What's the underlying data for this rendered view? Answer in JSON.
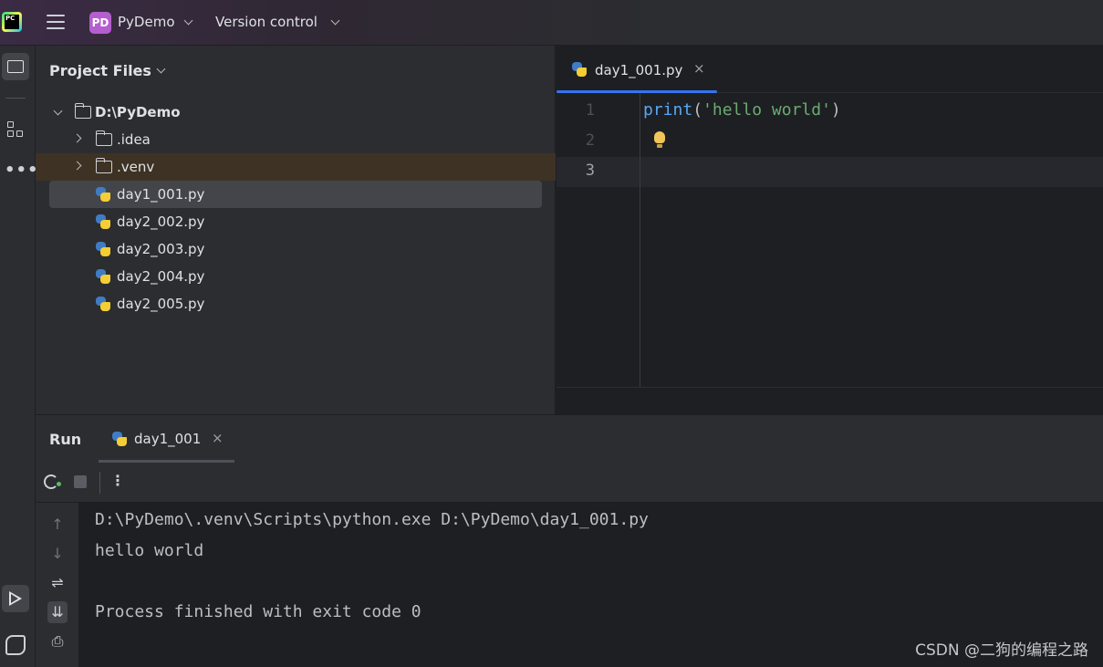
{
  "titlebar": {
    "app_logo_text": "PC",
    "project_badge": "PD",
    "project_name": "PyDemo",
    "vcs_label": "Version control"
  },
  "project_panel": {
    "title": "Project Files",
    "tree": [
      {
        "label": "D:\\PyDemo",
        "kind": "folder",
        "expanded": true
      },
      {
        "label": ".idea",
        "kind": "folder",
        "expanded": false
      },
      {
        "label": ".venv",
        "kind": "folder",
        "expanded": false
      },
      {
        "label": "day1_001.py",
        "kind": "python-file",
        "selected": true
      },
      {
        "label": "day2_002.py",
        "kind": "python-file"
      },
      {
        "label": "day2_003.py",
        "kind": "python-file"
      },
      {
        "label": "day2_004.py",
        "kind": "python-file"
      },
      {
        "label": "day2_005.py",
        "kind": "python-file"
      }
    ]
  },
  "editor": {
    "tab_label": "day1_001.py",
    "close_glyph": "×",
    "line_numbers": [
      "1",
      "2",
      "3"
    ],
    "code": {
      "fn": "print",
      "open_paren": "(",
      "string": "'hello world'",
      "close_paren": ")"
    },
    "current_line": "3"
  },
  "run_panel": {
    "title": "Run",
    "tab_label": "day1_001",
    "close_glyph": "×",
    "kebab_glyph": "⋮",
    "console_lines": [
      "D:\\PyDemo\\.venv\\Scripts\\python.exe D:\\PyDemo\\day1_001.py",
      "hello world",
      "",
      "Process finished with exit code 0"
    ],
    "side_icons": {
      "up": "↑",
      "down": "↓",
      "wrap": "⇌",
      "scroll_end": "⇊",
      "print": "⎙"
    }
  },
  "watermark": "CSDN @二狗的编程之路",
  "colors": {
    "accent": "#3574f0",
    "project_badge": "#b55ed0",
    "string": "#6aab73",
    "function": "#56a8f5",
    "venv_highlight": "#3d3223"
  }
}
